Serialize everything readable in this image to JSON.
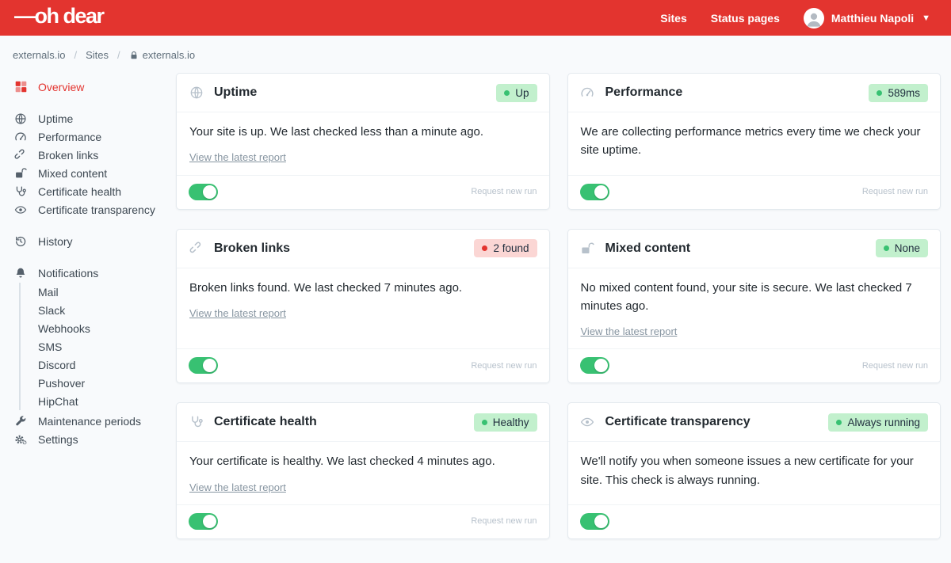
{
  "header": {
    "logo": "—oh dear",
    "nav": [
      {
        "label": "Sites"
      },
      {
        "label": "Status pages"
      }
    ],
    "user": {
      "name": "Matthieu Napoli"
    }
  },
  "breadcrumb": {
    "separator": "/",
    "items": [
      "externals.io",
      "Sites",
      "externals.io"
    ]
  },
  "sidebar": {
    "overview": {
      "label": "Overview",
      "icon": "grid-icon"
    },
    "checks": [
      {
        "label": "Uptime",
        "icon": "globe-icon"
      },
      {
        "label": "Performance",
        "icon": "gauge-icon"
      },
      {
        "label": "Broken links",
        "icon": "broken-link-icon"
      },
      {
        "label": "Mixed content",
        "icon": "unlock-icon"
      },
      {
        "label": "Certificate health",
        "icon": "stethoscope-icon"
      },
      {
        "label": "Certificate transparency",
        "icon": "eye-icon"
      }
    ],
    "history": {
      "label": "History",
      "icon": "history-icon"
    },
    "notifications": {
      "label": "Notifications",
      "icon": "bell-icon",
      "channels": [
        {
          "label": "Mail"
        },
        {
          "label": "Slack"
        },
        {
          "label": "Webhooks"
        },
        {
          "label": "SMS"
        },
        {
          "label": "Discord"
        },
        {
          "label": "Pushover"
        },
        {
          "label": "HipChat"
        }
      ]
    },
    "maintenance": {
      "label": "Maintenance periods",
      "icon": "wrench-icon"
    },
    "settings": {
      "label": "Settings",
      "icon": "gear-icon"
    }
  },
  "cards": [
    {
      "title": "Uptime",
      "icon": "globe-icon",
      "badge": {
        "label": "Up",
        "type": "success"
      },
      "body": "Your site is up. We last checked less than a minute ago.",
      "link_label": "View the latest report",
      "toggle_on": true,
      "footer_action": "Request new run"
    },
    {
      "title": "Performance",
      "icon": "gauge-icon",
      "badge": {
        "label": "589ms",
        "type": "success"
      },
      "body": "We are collecting performance metrics every time we check your site uptime.",
      "toggle_on": true,
      "footer_action": "Request new run"
    },
    {
      "title": "Broken links",
      "icon": "broken-link-icon",
      "badge": {
        "label": "2 found",
        "type": "danger"
      },
      "body": "Broken links found. We last checked 7 minutes ago.",
      "link_label": "View the latest report",
      "toggle_on": true,
      "footer_action": "Request new run"
    },
    {
      "title": "Mixed content",
      "icon": "unlock-icon",
      "badge": {
        "label": "None",
        "type": "success"
      },
      "body": "No mixed content found, your site is secure. We last checked 7 minutes ago.",
      "link_label": "View the latest report",
      "toggle_on": true,
      "footer_action": "Request new run"
    },
    {
      "title": "Certificate health",
      "icon": "stethoscope-icon",
      "badge": {
        "label": "Healthy",
        "type": "success"
      },
      "body": "Your certificate is healthy. We last checked 4 minutes ago.",
      "link_label": "View the latest report",
      "toggle_on": true,
      "footer_action": "Request new run"
    },
    {
      "title": "Certificate transparency",
      "icon": "eye-icon",
      "badge": {
        "label": "Always running",
        "type": "success"
      },
      "body": "We'll notify you when someone issues a new certificate for your site. This check is always running.",
      "toggle_on": true
    }
  ],
  "colors": {
    "brand_red": "#e3342f",
    "success_badge_bg": "#c2f0cd",
    "danger_badge_bg": "#fbd6d4",
    "success_dot": "#38c172",
    "danger_dot": "#e3342f",
    "toggle_on": "#38c172",
    "page_bg": "#f8fafc"
  }
}
